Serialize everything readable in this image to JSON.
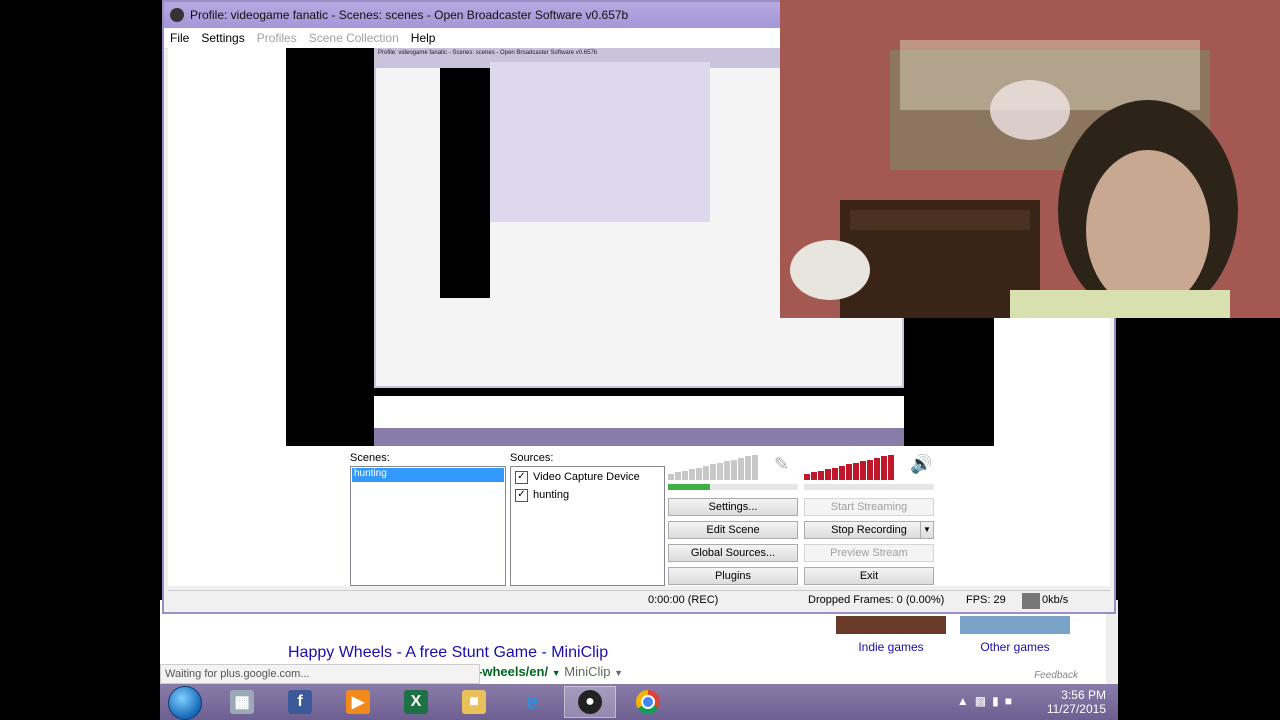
{
  "obs": {
    "title": "Profile: videogame fanatic - Scenes: scenes - Open Broadcaster Software v0.657b",
    "menu": [
      {
        "label": "File",
        "enabled": true
      },
      {
        "label": "Settings",
        "enabled": true
      },
      {
        "label": "Profiles",
        "enabled": false
      },
      {
        "label": "Scene Collection",
        "enabled": false
      },
      {
        "label": "Help",
        "enabled": true
      }
    ],
    "scenes_label": "Scenes:",
    "scenes": [
      "hunting"
    ],
    "sources_label": "Sources:",
    "sources": [
      {
        "label": "Video Capture Device",
        "checked": true
      },
      {
        "label": "hunting",
        "checked": true
      }
    ],
    "buttons": {
      "settings": "Settings...",
      "start_streaming": "Start Streaming",
      "edit_scene": "Edit Scene",
      "stop_recording": "Stop Recording",
      "global_sources": "Global Sources...",
      "preview_stream": "Preview Stream",
      "plugins": "Plugins",
      "exit": "Exit"
    },
    "status": {
      "time": "0:00:00 (REC)",
      "dropped": "Dropped Frames: 0 (0.00%)",
      "fps": "FPS: 29",
      "bitrate": "0kb/s"
    },
    "colors": {
      "meter_green": "#3cb043",
      "meter_red": "#c0182a",
      "selection": "#3399ff"
    }
  },
  "browser": {
    "result_title": "Happy Wheels - A free Stunt Game - MiniClip",
    "result_url_bold": "-wheels/en/",
    "result_url_rest": "MiniClip",
    "status_text": "Waiting for plus.google.com...",
    "cards": [
      "Indie games",
      "Other games"
    ],
    "feedback": "Feedback"
  },
  "taskbar": {
    "time": "3:56 PM",
    "date": "11/27/2015",
    "apps": [
      "calculator-icon",
      "facebook-icon",
      "media-player-icon",
      "excel-icon",
      "file-explorer-icon",
      "internet-explorer-icon",
      "obs-icon",
      "chrome-icon"
    ]
  }
}
